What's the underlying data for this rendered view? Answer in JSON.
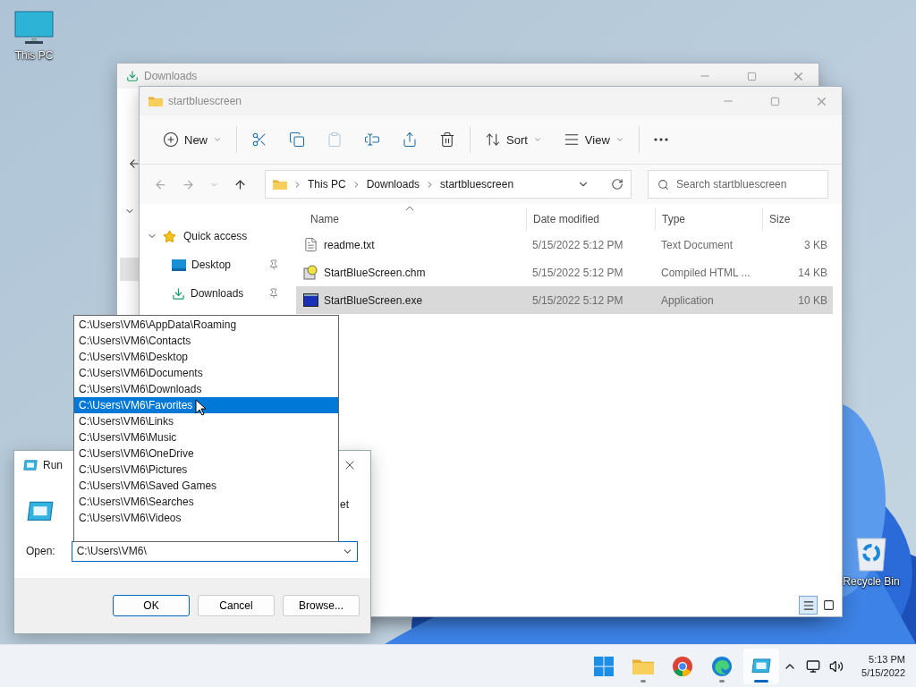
{
  "desktop_icons": [
    {
      "label": "This PC",
      "kind": "pc"
    },
    {
      "label": "Recycle Bin",
      "kind": "bin"
    }
  ],
  "back_window": {
    "title": "Downloads"
  },
  "explorer": {
    "title": "startbluescreen",
    "toolbar": [
      {
        "items": [
          {
            "kind": "new",
            "label": "New",
            "disabled": false
          }
        ]
      },
      {
        "items": [
          {
            "kind": "cut",
            "disabled": false
          },
          {
            "kind": "copy",
            "disabled": false
          },
          {
            "kind": "paste",
            "disabled": true
          },
          {
            "kind": "rename",
            "disabled": false
          },
          {
            "kind": "share",
            "disabled": false
          },
          {
            "kind": "delete",
            "disabled": false
          }
        ]
      },
      {
        "items": [
          {
            "kind": "sort",
            "label": "Sort",
            "disabled": false
          },
          {
            "kind": "view",
            "label": "View",
            "disabled": false
          }
        ]
      },
      {
        "items": [
          {
            "kind": "more",
            "disabled": false
          }
        ]
      }
    ],
    "path": [
      "This PC",
      "Downloads",
      "startbluescreen"
    ],
    "search": {
      "placeholder": "Search startbluescreen"
    },
    "nav": [
      {
        "label": "Quick access",
        "kind": "star",
        "expanded": true,
        "children": [
          {
            "label": "Desktop",
            "kind": "desktop",
            "pinned": true
          },
          {
            "label": "Downloads",
            "kind": "downloads",
            "pinned": true
          }
        ]
      }
    ],
    "columns": [
      {
        "label": "Name",
        "sorted": true
      },
      {
        "label": "Date modified",
        "sorted": false
      },
      {
        "label": "Type",
        "sorted": false
      },
      {
        "label": "Size",
        "sorted": false
      }
    ],
    "files": [
      {
        "name": "readme.txt",
        "kind": "text",
        "date": "5/15/2022 5:12 PM",
        "type": "Text Document",
        "size": "3 KB",
        "selected": false
      },
      {
        "name": "StartBlueScreen.chm",
        "kind": "help",
        "date": "5/15/2022 5:12 PM",
        "type": "Compiled HTML ...",
        "size": "14 KB",
        "selected": false
      },
      {
        "name": "StartBlueScreen.exe",
        "kind": "app",
        "date": "5/15/2022 5:12 PM",
        "type": "Application",
        "size": "10 KB",
        "selected": true
      }
    ],
    "view_modes": [
      {
        "kind": "details",
        "selected": true
      },
      {
        "kind": "tiles",
        "selected": false
      }
    ]
  },
  "run_dialog": {
    "title": "Run",
    "text_right": "et",
    "open_label": "Open:",
    "value": "C:\\Users\\VM6\\",
    "suggestions": [
      {
        "path": "C:\\Users\\VM6\\AppData\\Roaming",
        "selected": false
      },
      {
        "path": "C:\\Users\\VM6\\Contacts",
        "selected": false
      },
      {
        "path": "C:\\Users\\VM6\\Desktop",
        "selected": false
      },
      {
        "path": "C:\\Users\\VM6\\Documents",
        "selected": false
      },
      {
        "path": "C:\\Users\\VM6\\Downloads",
        "selected": false
      },
      {
        "path": "C:\\Users\\VM6\\Favorites",
        "selected": true
      },
      {
        "path": "C:\\Users\\VM6\\Links",
        "selected": false
      },
      {
        "path": "C:\\Users\\VM6\\Music",
        "selected": false
      },
      {
        "path": "C:\\Users\\VM6\\OneDrive",
        "selected": false
      },
      {
        "path": "C:\\Users\\VM6\\Pictures",
        "selected": false
      },
      {
        "path": "C:\\Users\\VM6\\Saved Games",
        "selected": false
      },
      {
        "path": "C:\\Users\\VM6\\Searches",
        "selected": false
      },
      {
        "path": "C:\\Users\\VM6\\Videos",
        "selected": false
      }
    ],
    "buttons": [
      {
        "label": "OK",
        "default": true
      },
      {
        "label": "Cancel",
        "default": false
      },
      {
        "label": "Browse...",
        "default": false
      }
    ]
  },
  "taskbar": {
    "apps": [
      {
        "kind": "start",
        "running": false,
        "active": false
      },
      {
        "kind": "explorer",
        "running": true,
        "active": false
      },
      {
        "kind": "chrome",
        "running": false,
        "active": false
      },
      {
        "kind": "edge",
        "running": true,
        "active": false
      },
      {
        "kind": "run",
        "running": true,
        "active": true
      }
    ],
    "time": "5:13 PM",
    "date": "5/15/2022"
  }
}
